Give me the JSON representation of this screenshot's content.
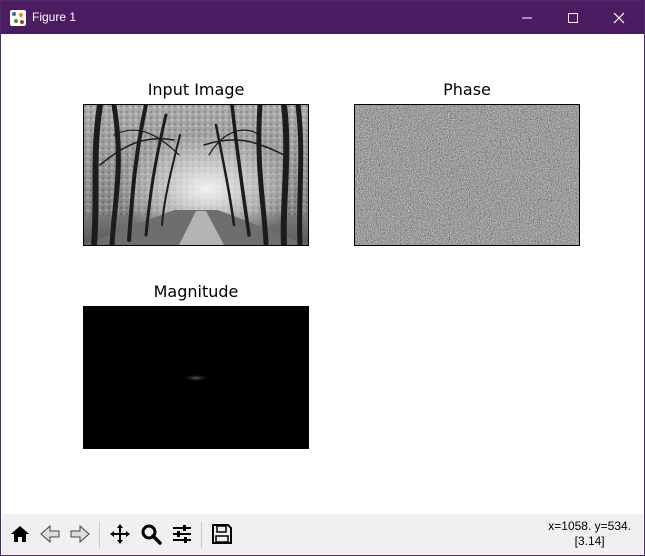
{
  "window": {
    "title": "Figure 1",
    "minimize_icon": "minimize-icon",
    "maximize_icon": "maximize-icon",
    "close_icon": "close-icon",
    "titlebar_color": "#4b1c62"
  },
  "figure": {
    "subplots": [
      {
        "title": "Input Image",
        "content": "grayscale forest photograph"
      },
      {
        "title": "Phase",
        "content": "gray noise"
      },
      {
        "title": "Magnitude",
        "content": "black field with faint central spot"
      }
    ]
  },
  "toolbar": {
    "buttons": [
      {
        "name": "home",
        "icon": "home-icon"
      },
      {
        "name": "back",
        "icon": "back-arrow-icon"
      },
      {
        "name": "forward",
        "icon": "forward-arrow-icon"
      },
      {
        "name": "pan",
        "icon": "move-icon"
      },
      {
        "name": "zoom",
        "icon": "zoom-icon"
      },
      {
        "name": "configure",
        "icon": "sliders-icon"
      },
      {
        "name": "save",
        "icon": "save-icon"
      }
    ],
    "coords_line1": "x=1058. y=534.",
    "coords_line2": "[3.14]"
  }
}
